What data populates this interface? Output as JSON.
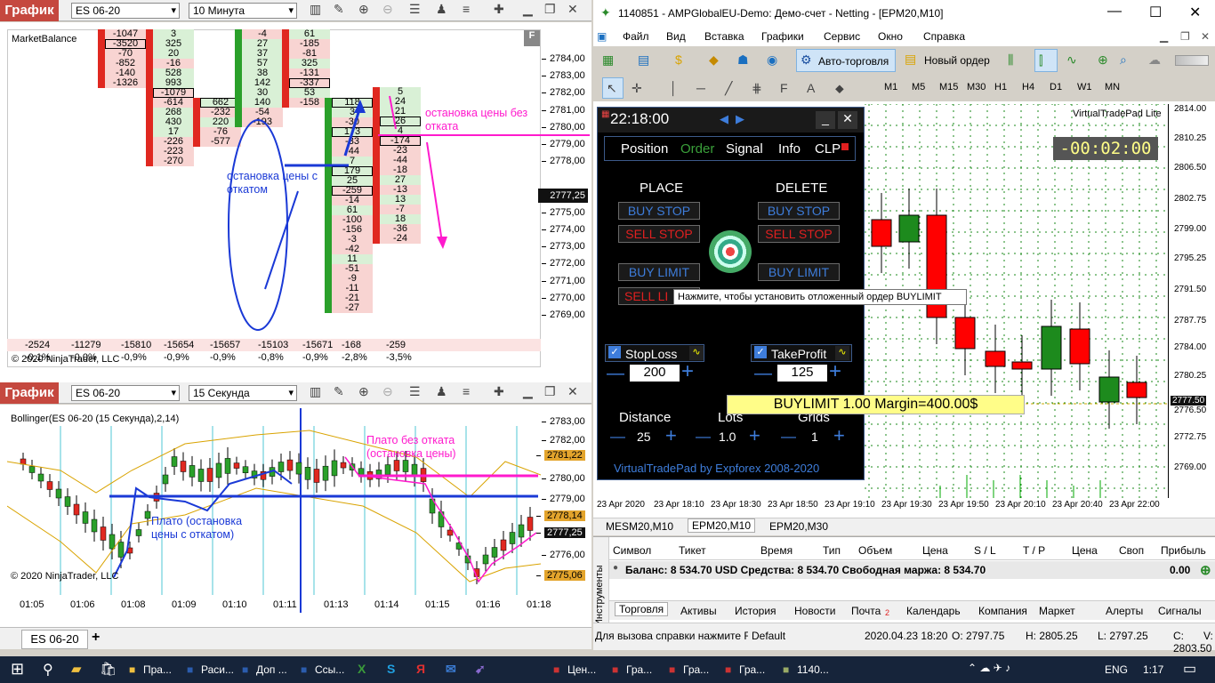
{
  "nt_top": {
    "btn": "График",
    "instrument": "ES 06-20",
    "interval": "10 Минута",
    "indicator": "MarketBalance",
    "copyright": "© 2020 NinjaTrader, LLC"
  },
  "nt_axis1": [
    "2784,00",
    "2783,00",
    "2782,00",
    "2781,00",
    "2780,00",
    "2779,00",
    "2778,00",
    "2777,25",
    "2776,00",
    "2775,00",
    "2774,00",
    "2773,00",
    "2772,00",
    "2771,00",
    "2770,00",
    "2769,00"
  ],
  "nt_cols": [
    {
      "cells": [
        "-1047",
        "-3520",
        "-70",
        "-852",
        "-140",
        "-1326"
      ],
      "total": "-2524",
      "pct": "-0,1%"
    },
    {
      "cells": [
        "3",
        "325",
        "20",
        "-16",
        "528",
        "993",
        "-1079",
        "-614",
        "268",
        "430",
        "17",
        "-226",
        "-223",
        "-270"
      ],
      "total": "-11279",
      "pct": "-0,0%"
    },
    {
      "cells": [
        "662",
        "-232",
        "220",
        "-76",
        "-577"
      ],
      "total": "-15810",
      "pct": "-0,9%"
    },
    {
      "cells": [
        "-4",
        "27",
        "37",
        "57",
        "38",
        "142",
        "30",
        "140",
        "-54",
        "-193"
      ],
      "total": "-15654",
      "pct": "-0,9%"
    },
    {
      "cells": [
        "61",
        "-185",
        "-81",
        "325",
        "-131",
        "-337",
        "53",
        "-158"
      ],
      "total": "-15657",
      "pct": "-0,9%"
    },
    {
      "cells": [
        "118",
        "3",
        "-30",
        "173",
        "-33",
        "-44",
        "7",
        "179",
        "25",
        "-259",
        "-14",
        "61",
        "-100",
        "-156",
        "-3",
        "-42",
        "11",
        "-51",
        "-9",
        "-11",
        "-21",
        "-27"
      ],
      "total": "-15103",
      "pct": "-0,8%"
    },
    {
      "cells": [
        "5",
        "24",
        "21",
        "26",
        "4",
        "-174",
        "-23",
        "-44",
        "-18",
        "27",
        "-13",
        "13",
        "-7",
        "18",
        "-36",
        "-24"
      ],
      "total": "-15671",
      "pct": "-0,9%"
    }
  ],
  "nt_extra_totals": [
    {
      "total": "-168",
      "pct": "-2,8%"
    },
    {
      "total": "-259",
      "pct": "-3,5%"
    }
  ],
  "nt_annot": {
    "blue": "остановка цены с откатом",
    "magenta": "остановка цены без отката",
    "price_tag": "2777,25"
  },
  "nt_bot": {
    "btn": "График",
    "instrument": "ES 06-20",
    "interval": "15 Секунда",
    "indicator": "Bollinger(ES 06-20 (15 Секунда),2,14)",
    "annot_blue": "Плато (остановка цены с откатом)",
    "annot_mag": "Плато без отката (остановка цены)",
    "copyright": "© 2020 NinjaTrader, LLC",
    "tab": "ES 06-20"
  },
  "nt_axis2": [
    "2783,00",
    "2782,00",
    "2781,22",
    "2780,00",
    "2779,00",
    "2778,14",
    "2777,25",
    "2776,00",
    "2775,06"
  ],
  "nt_time2": [
    "01:05",
    "01:06",
    "01:08",
    "01:09",
    "01:10",
    "01:11",
    "01:13",
    "01:14",
    "01:15",
    "01:16",
    "01:18"
  ],
  "mt": {
    "title": "1140851 - AMPGlobalEU-Demo: Демо-счет - Netting - [EPM20,M10]",
    "menu": [
      "Файл",
      "Вид",
      "Вставка",
      "Графики",
      "Сервис",
      "Окно",
      "Справка"
    ],
    "auto": "Авто-торговля",
    "new_order": "Новый ордер",
    "tf": [
      "M1",
      "M5",
      "M15",
      "M30",
      "H1",
      "H4",
      "D1",
      "W1",
      "MN"
    ],
    "axis": [
      "2814.00",
      "2810.25",
      "2806.50",
      "2802.75",
      "2799.00",
      "2795.25",
      "2791.50",
      "2787.75",
      "2784.00",
      "2780.25",
      "2777.50",
      "2776.50",
      "2772.75",
      "2769.00"
    ],
    "times": [
      "23 Apr 2020",
      "23 Apr 18:10",
      "23 Apr 18:30",
      "23 Apr 18:50",
      "23 Apr 19:10",
      "23 Apr 19:30",
      "23 Apr 19:50",
      "23 Apr 20:10",
      "23 Apr 20:40",
      "23 Apr 22:00"
    ],
    "vtp_brand": "VirtualTradePad  Lite",
    "countdown": "-00:02:00",
    "chart_tabs": [
      "MESM20,M10",
      "EPM20,M10",
      "EPM20,M30"
    ],
    "cols": [
      "Символ",
      "Тикет",
      "Время",
      "Тип",
      "Объем",
      "Цена",
      "S / L",
      "T / P",
      "Цена",
      "Своп",
      "Прибыль"
    ],
    "balance": "Баланс: 8 534.70 USD  Средства: 8 534.70  Свободная маржа: 8 534.70",
    "profit": "0.00",
    "bottom_tabs": [
      "Торговля",
      "Активы",
      "История",
      "Новости",
      "Почта",
      "Календарь",
      "Компания",
      "Маркет",
      "Алерты",
      "Сигналы"
    ],
    "mail_badge": "2",
    "side": "Инструменты",
    "status": [
      "Для вызова справки нажмите F1",
      "Default",
      "2020.04.23 18:20",
      "O: 2797.75",
      "H: 2805.25",
      "L: 2797.25",
      "C: 2803.50",
      "V:"
    ]
  },
  "vtp": {
    "time": "22:18:00",
    "tabs": [
      "Position",
      "Order",
      "Signal",
      "Info",
      "CLP"
    ],
    "place": "PLACE",
    "delete": "DELETE",
    "buy_stop": "BUY STOP",
    "sell_stop": "SELL STOP",
    "buy_limit": "BUY LIMIT",
    "sell_limit": "SELL LI",
    "tooltip": "Нажмите, чтобы установить отложенный ордер BUYLIMIT",
    "stoploss": "StopLoss",
    "sl_val": "200",
    "takeprofit": "TakeProfit",
    "tp_val": "125",
    "order_info": "BUYLIMIT 1.00 Margin=400.00$",
    "distance": "Distance",
    "dist_val": "25",
    "lots": "Lots",
    "lots_val": "1.0",
    "grids": "Grids",
    "grids_val": "1",
    "footer": "VirtualTradePad by Expforex 2008-2020"
  },
  "taskbar": {
    "apps": [
      "Пра...",
      "Раси...",
      "Доп ...",
      "Ссы...",
      "Цен...",
      "Гра...",
      "Гра...",
      "Гра...",
      "1140..."
    ],
    "lang": "ENG",
    "clock": "1:17"
  }
}
